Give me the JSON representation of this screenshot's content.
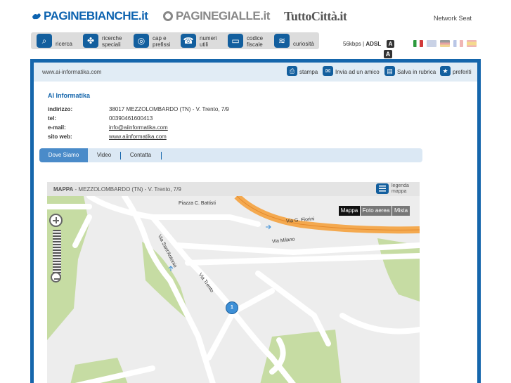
{
  "brands": {
    "paginebianche": "PAGINEBIANCHE.it",
    "paginegialle": "PAGINEGIALLE.it",
    "tuttocitta": "TuttoCittà.it",
    "network": "Network Seat"
  },
  "services": [
    {
      "label": "ricerca",
      "icon": "search-icon"
    },
    {
      "label": "ricerche\nspeciali",
      "icon": "puzzle-icon"
    },
    {
      "label": "cap e\nprefissi",
      "icon": "globe-icon"
    },
    {
      "label": "numeri\nutili",
      "icon": "phone-icon"
    },
    {
      "label": "codice\nfiscale",
      "icon": "card-icon"
    },
    {
      "label": "curiosità",
      "icon": "question-icon"
    }
  ],
  "connection": {
    "speed": "56kbps",
    "type": "ADSL"
  },
  "font_size": {
    "small": "A",
    "large": "A"
  },
  "url": "www.ai-informatika.com",
  "toolbar": {
    "print": "stampa",
    "send": "Invia ad un amico",
    "save": "Salva in rubrica",
    "favorites": "preferiti"
  },
  "business": {
    "name": "AI Informatika",
    "address_label": "indirizzo:",
    "address": "38017 MEZZOLOMBARDO (TN) - V. Trento, 7/9",
    "tel_label": "tel:",
    "tel": "00390461600413",
    "email_label": "e-mail:",
    "email": "info@aiinformatika.com",
    "web_label": "sito web:",
    "web": "www.aiinformatika.com"
  },
  "tabs": [
    {
      "label": "Dove Siamo",
      "active": true
    },
    {
      "label": "Video",
      "active": false
    },
    {
      "label": "Contatta",
      "active": false
    }
  ],
  "map": {
    "title": "MAPPA",
    "subtitle": " - MEZZOLOMBARDO (TN) - V. Trento, 7/9",
    "legend": "legenda\nmappa",
    "types": [
      "Mappa",
      "Foto aerea",
      "Mista"
    ],
    "marker": "1",
    "streets": {
      "piazza": "Piazza C. Battisti",
      "fiorini": "Via G. Fiorini",
      "milano": "Via Milano",
      "sant_antonio": "Via Sant'Antonio",
      "trento": "Via Trento"
    }
  },
  "colors": {
    "brand_blue": "#1566ac",
    "icon_blue": "#135f9e",
    "tab_active": "#4a8bc9",
    "road_orange": "#f4a94f",
    "park_green": "#c6dca3"
  }
}
